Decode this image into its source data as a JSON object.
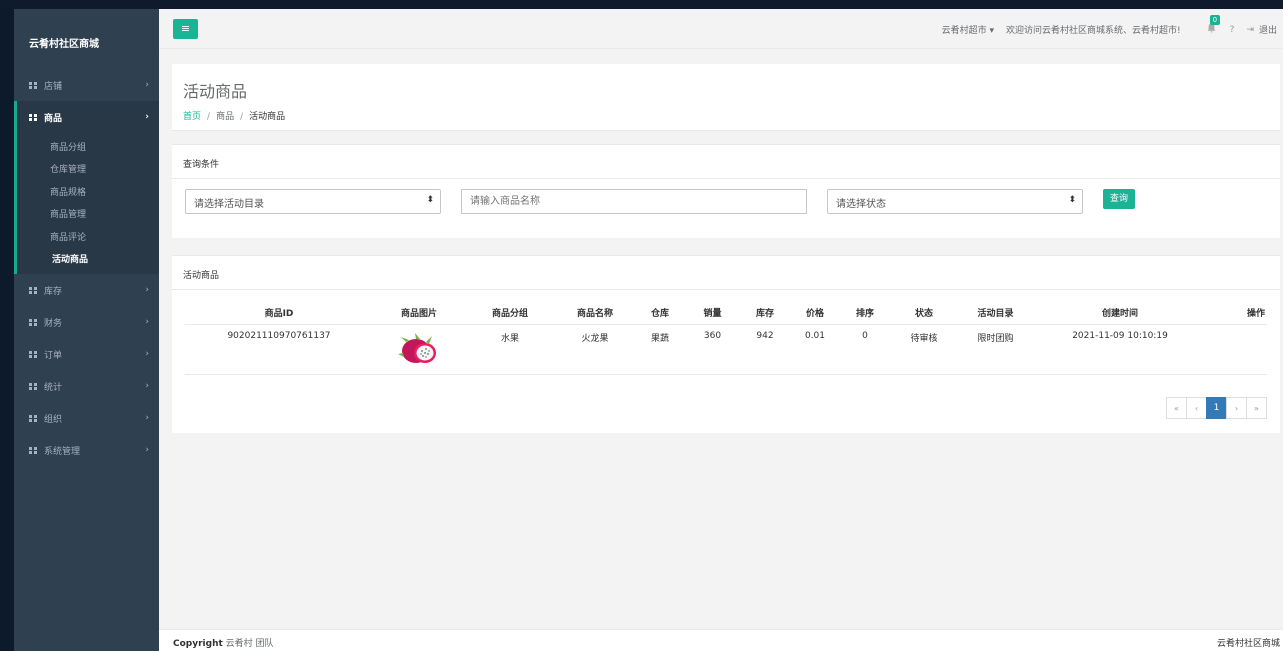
{
  "sidebar": {
    "brand": "云肴村社区商城",
    "nav": [
      {
        "label": "店铺"
      },
      {
        "label": "商品"
      },
      {
        "label": "库存"
      },
      {
        "label": "财务"
      },
      {
        "label": "订单"
      },
      {
        "label": "统计"
      },
      {
        "label": "组织"
      },
      {
        "label": "系统管理"
      }
    ],
    "sub_items": [
      "商品分组",
      "仓库管理",
      "商品规格",
      "商品管理",
      "商品评论",
      "活动商品"
    ],
    "active_sub": "活动商品",
    "chevron": "›"
  },
  "topbar": {
    "menu_icon": "≡",
    "user": "云肴村超市 ▾",
    "welcome": "欢迎访问云肴村社区商城系统、云肴村超市!",
    "notification_count": "0",
    "help_icon": "?",
    "logout_icon": "⇥",
    "logout": "退出"
  },
  "page": {
    "title": "活动商品",
    "breadcrumb": {
      "home": "首页",
      "sep": "/",
      "level1": "商品",
      "current": "活动商品"
    }
  },
  "query": {
    "title": "查询条件",
    "catalog_select": "请选择活动目录",
    "name_placeholder": "请输入商品名称",
    "status_select": "请选择状态",
    "select_arrows": "⬍",
    "button": "查询"
  },
  "list": {
    "title": "活动商品",
    "columns": [
      "商品ID",
      "商品图片",
      "商品分组",
      "商品名称",
      "仓库",
      "销量",
      "库存",
      "价格",
      "排序",
      "状态",
      "活动目录",
      "创建时间",
      "操作"
    ],
    "rows": [
      {
        "id": "902021110970761137",
        "group": "水果",
        "name": "火龙果",
        "warehouse": "果蔬",
        "sales": "360",
        "stock": "942",
        "price": "0.01",
        "sort": "0",
        "status": "待审核",
        "catalog": "限时团购",
        "created": "2021-11-09 10:10:19",
        "op": ""
      }
    ],
    "pagination": {
      "first": "«",
      "prev": "‹",
      "current": "1",
      "next": "›",
      "last": "»"
    }
  },
  "footer": {
    "copyright_label": "Copyright",
    "copyright_owner": "云肴村 团队",
    "right": "云肴村社区商城"
  },
  "colors": {
    "sidebar": "#2f4050",
    "sidebar_active": "#293846",
    "accent": "#1ab394",
    "pager_active": "#337ab7",
    "content_bg": "#f3f3f4"
  }
}
